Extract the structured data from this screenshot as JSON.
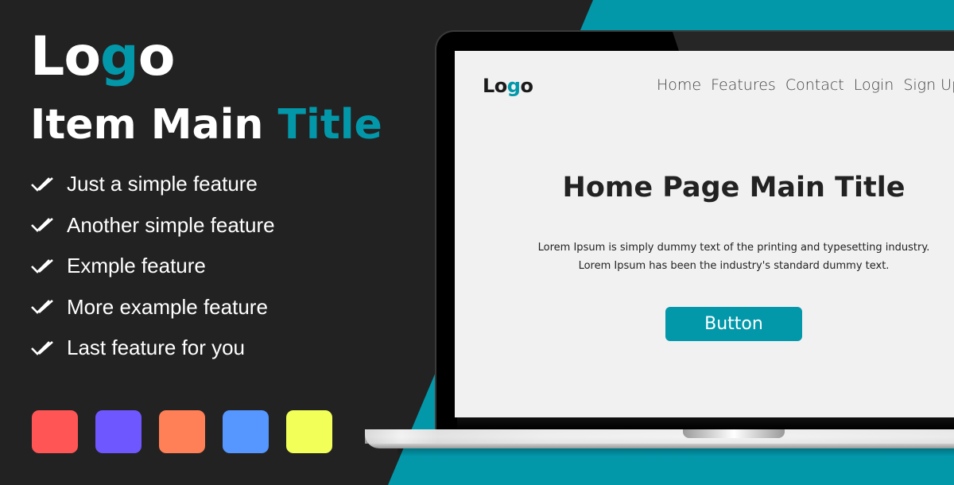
{
  "colors": {
    "background": "#222222",
    "accent": "#0298aa",
    "screen_bg": "#f1f1f1"
  },
  "brand": {
    "logo_prefix": "Lo",
    "logo_accent": "g",
    "logo_suffix": "o"
  },
  "title": {
    "main": "Item Main ",
    "accent": "Title"
  },
  "features": [
    {
      "icon": "double-check-icon",
      "label": "Just a simple feature"
    },
    {
      "icon": "double-check-icon",
      "label": "Another simple feature"
    },
    {
      "icon": "double-check-icon",
      "label": "Exmple feature"
    },
    {
      "icon": "double-check-icon",
      "label": "More example feature"
    },
    {
      "icon": "double-check-icon",
      "label": "Last feature for you"
    }
  ],
  "swatches": [
    "#ff5555",
    "#6e57ff",
    "#ff7f56",
    "#5596ff",
    "#f2ff58"
  ],
  "screen": {
    "logo_prefix": "Lo",
    "logo_accent": "g",
    "logo_suffix": "o",
    "nav": [
      "Home",
      "Features",
      "Contact",
      "Login",
      "Sign Up"
    ],
    "hero_title": "Home Page Main Title",
    "hero_line1": "Lorem Ipsum is simply dummy text of the printing and typesetting industry.",
    "hero_line2": "Lorem Ipsum has been the industry's standard dummy text.",
    "button_label": "Button"
  }
}
